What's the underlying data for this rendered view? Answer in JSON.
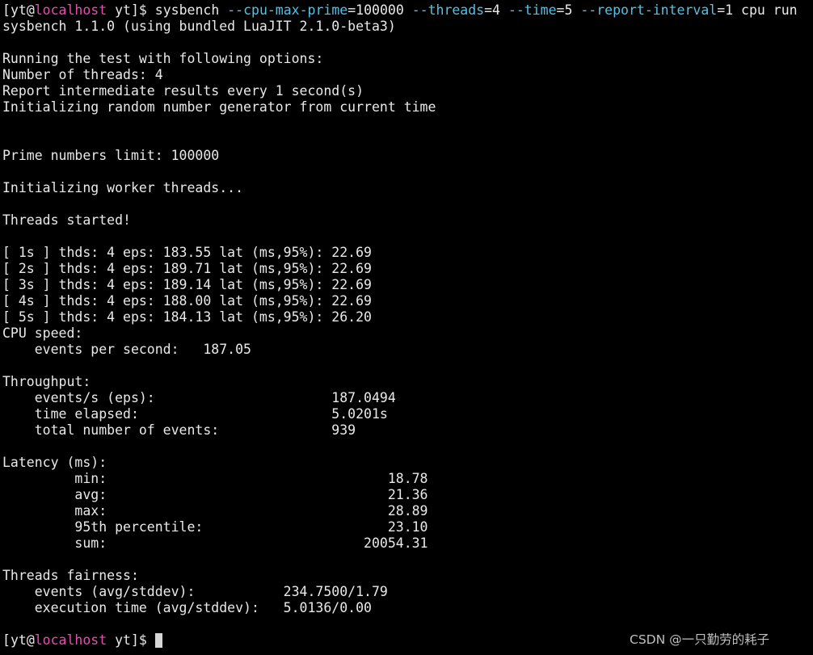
{
  "prompt": {
    "user": "yt",
    "at": "@",
    "host": "localhost",
    "cwd": "yt"
  },
  "command": {
    "name": "sysbench",
    "flag_cpu_max_prime": "--cpu-max-prime",
    "val_cpu_max_prime": "100000",
    "flag_threads": "--threads",
    "val_threads": "4",
    "flag_time": "--time",
    "val_time": "5",
    "flag_report_interval": "--report-interval",
    "val_report_interval": "1",
    "args": "cpu run"
  },
  "output": {
    "lines": [
      "sysbench 1.1.0 (using bundled LuaJIT 2.1.0-beta3)",
      "",
      "Running the test with following options:",
      "Number of threads: 4",
      "Report intermediate results every 1 second(s)",
      "Initializing random number generator from current time",
      "",
      "",
      "Prime numbers limit: 100000",
      "",
      "Initializing worker threads...",
      "",
      "Threads started!",
      "",
      "[ 1s ] thds: 4 eps: 183.55 lat (ms,95%): 22.69",
      "[ 2s ] thds: 4 eps: 189.71 lat (ms,95%): 22.69",
      "[ 3s ] thds: 4 eps: 189.14 lat (ms,95%): 22.69",
      "[ 4s ] thds: 4 eps: 188.00 lat (ms,95%): 22.69",
      "[ 5s ] thds: 4 eps: 184.13 lat (ms,95%): 26.20",
      "CPU speed:",
      "    events per second:   187.05",
      "",
      "Throughput:",
      "    events/s (eps):                      187.0494",
      "    time elapsed:                        5.0201s",
      "    total number of events:              939",
      "",
      "Latency (ms):",
      "         min:                                   18.78",
      "         avg:                                   21.36",
      "         max:                                   28.89",
      "         95th percentile:                       23.10",
      "         sum:                                20054.31",
      "",
      "Threads fairness:",
      "    events (avg/stddev):           234.7500/1.79",
      "    execution time (avg/stddev):   5.0136/0.00",
      ""
    ]
  },
  "watermark": "CSDN @一只勤劳的耗子",
  "colors": {
    "background": "#000000",
    "text": "#e9e9e9",
    "host": "#e34fb0",
    "flag": "#4fc3e8",
    "watermark": "#bfbfbf"
  }
}
